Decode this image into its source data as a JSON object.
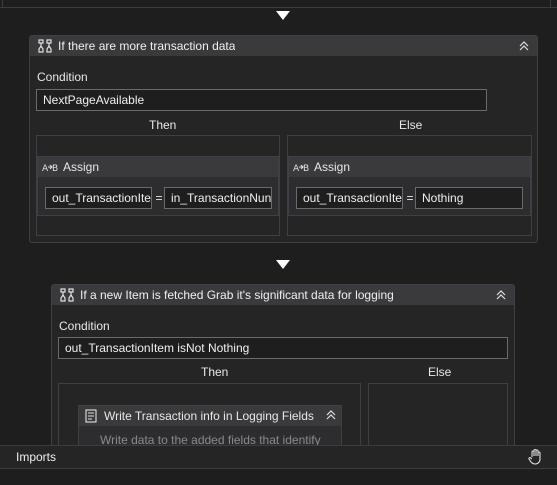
{
  "designer": {
    "imports_label": "Imports"
  },
  "if_block_1": {
    "title": "If there are more transaction data",
    "condition_label": "Condition",
    "condition_value": "NextPageAvailable",
    "then_label": "Then",
    "else_label": "Else",
    "then_assign": {
      "title": "Assign",
      "to": "out_TransactionIte",
      "equals": "=",
      "value": "in_TransactionNun"
    },
    "else_assign": {
      "title": "Assign",
      "to": "out_TransactionIte",
      "equals": "=",
      "value": "Nothing"
    }
  },
  "if_block_2": {
    "title": "If a new Item is fetched Grab it's significant data for logging",
    "condition_label": "Condition",
    "condition_value": "out_TransactionItem isNot Nothing",
    "then_label": "Then",
    "else_label": "Else",
    "then_activity": {
      "title": "Write Transaction info in Logging Fields",
      "description": "Write data to the added fields that identify"
    }
  },
  "colors": {
    "background": "#1e1e1e",
    "header": "#3a3a3d",
    "border": "#3f3f46",
    "text": "#e8e8e8"
  }
}
